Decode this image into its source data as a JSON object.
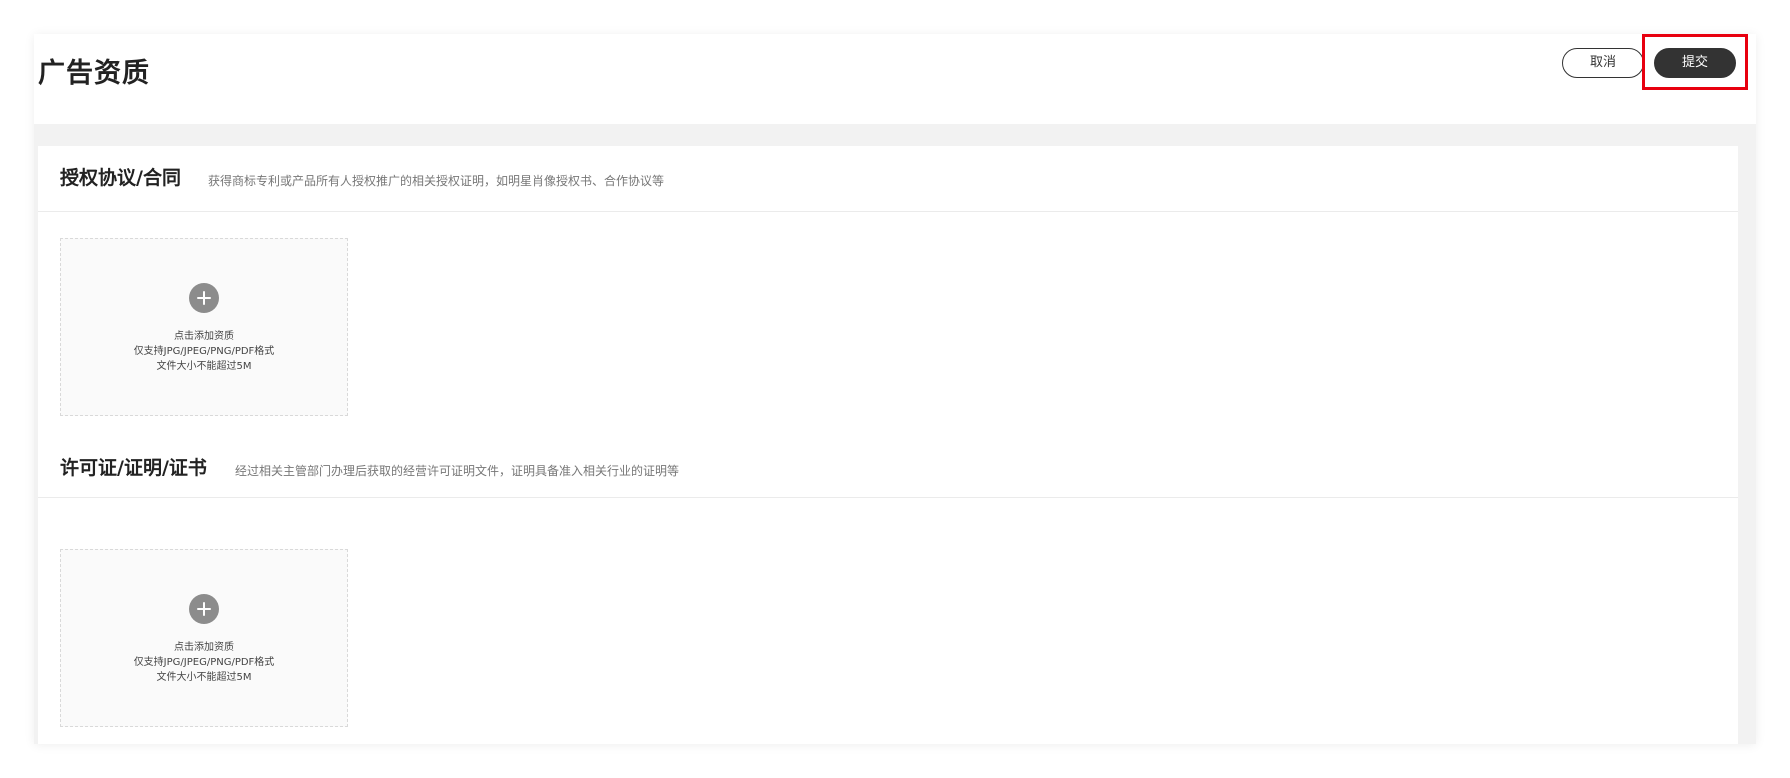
{
  "header": {
    "title": "广告资质",
    "cancel_label": "取消",
    "submit_label": "提交"
  },
  "sections": [
    {
      "title": "授权协议/合同",
      "description": "获得商标专利或产品所有人授权推广的相关授权证明，如明星肖像授权书、合作协议等",
      "upload": {
        "action": "点击添加资质",
        "formats": "仅支持JPG/JPEG/PNG/PDF格式",
        "size_limit": "文件大小不能超过5M"
      }
    },
    {
      "title": "许可证/证明/证书",
      "description": "经过相关主管部门办理后获取的经营许可证明文件，证明具备准入相关行业的证明等",
      "upload": {
        "action": "点击添加资质",
        "formats": "仅支持JPG/JPEG/PNG/PDF格式",
        "size_limit": "文件大小不能超过5M"
      }
    }
  ],
  "icons": {
    "upload": "plus-circle-icon"
  },
  "colors": {
    "primary_button": "#333333",
    "highlight": "#e8000f",
    "background": "#f2f2f2"
  }
}
